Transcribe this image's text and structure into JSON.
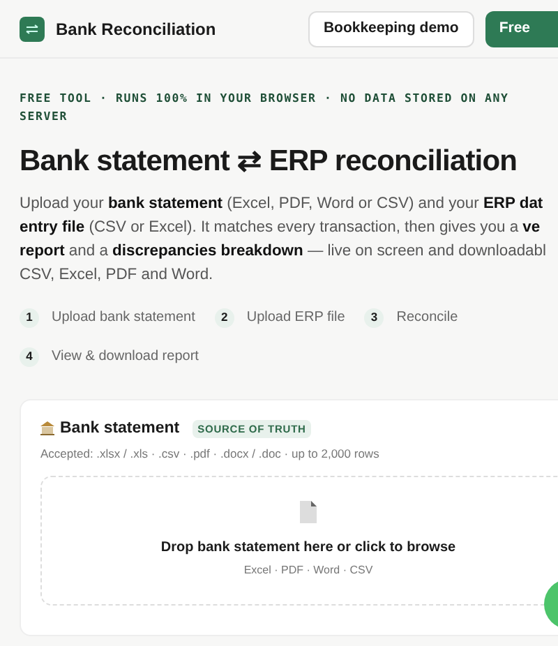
{
  "header": {
    "title": "Bank Reconciliation",
    "buttons": [
      "Bookkeeping demo",
      "Free"
    ]
  },
  "eyebrow": "FREE TOOL · RUNS 100% IN YOUR BROWSER · NO DATA STORED ON ANY SERVER",
  "heading": "Bank statement ⇄ ERP reconciliation",
  "intro_lines": [
    "Upload your **bank statement** (Excel, PDF, Word or CSV) and your **ERP dat**",
    "**entry file** (CSV or Excel). It matches every transaction, then gives you a **ve**",
    "**report** and a **discrepancies breakdown** — live on screen and downloadabl",
    "CSV, Excel, PDF and Word."
  ],
  "steps": [
    {
      "number": "1",
      "label": "Upload bank statement"
    },
    {
      "number": "2",
      "label": "Upload ERP file"
    },
    {
      "number": "3",
      "label": "Reconcile"
    },
    {
      "number": "4",
      "label": "View & download report"
    }
  ],
  "upload_card": {
    "title": "Bank statement",
    "badge": "SOURCE OF TRUTH",
    "accepted": "Accepted: .xlsx / .xls · .csv · .pdf · .docx / .doc · up to 2,000 rows",
    "dropzone": {
      "prompt": "Drop bank statement here or click to browse",
      "formats": "Excel · PDF · Word · CSV"
    }
  }
}
